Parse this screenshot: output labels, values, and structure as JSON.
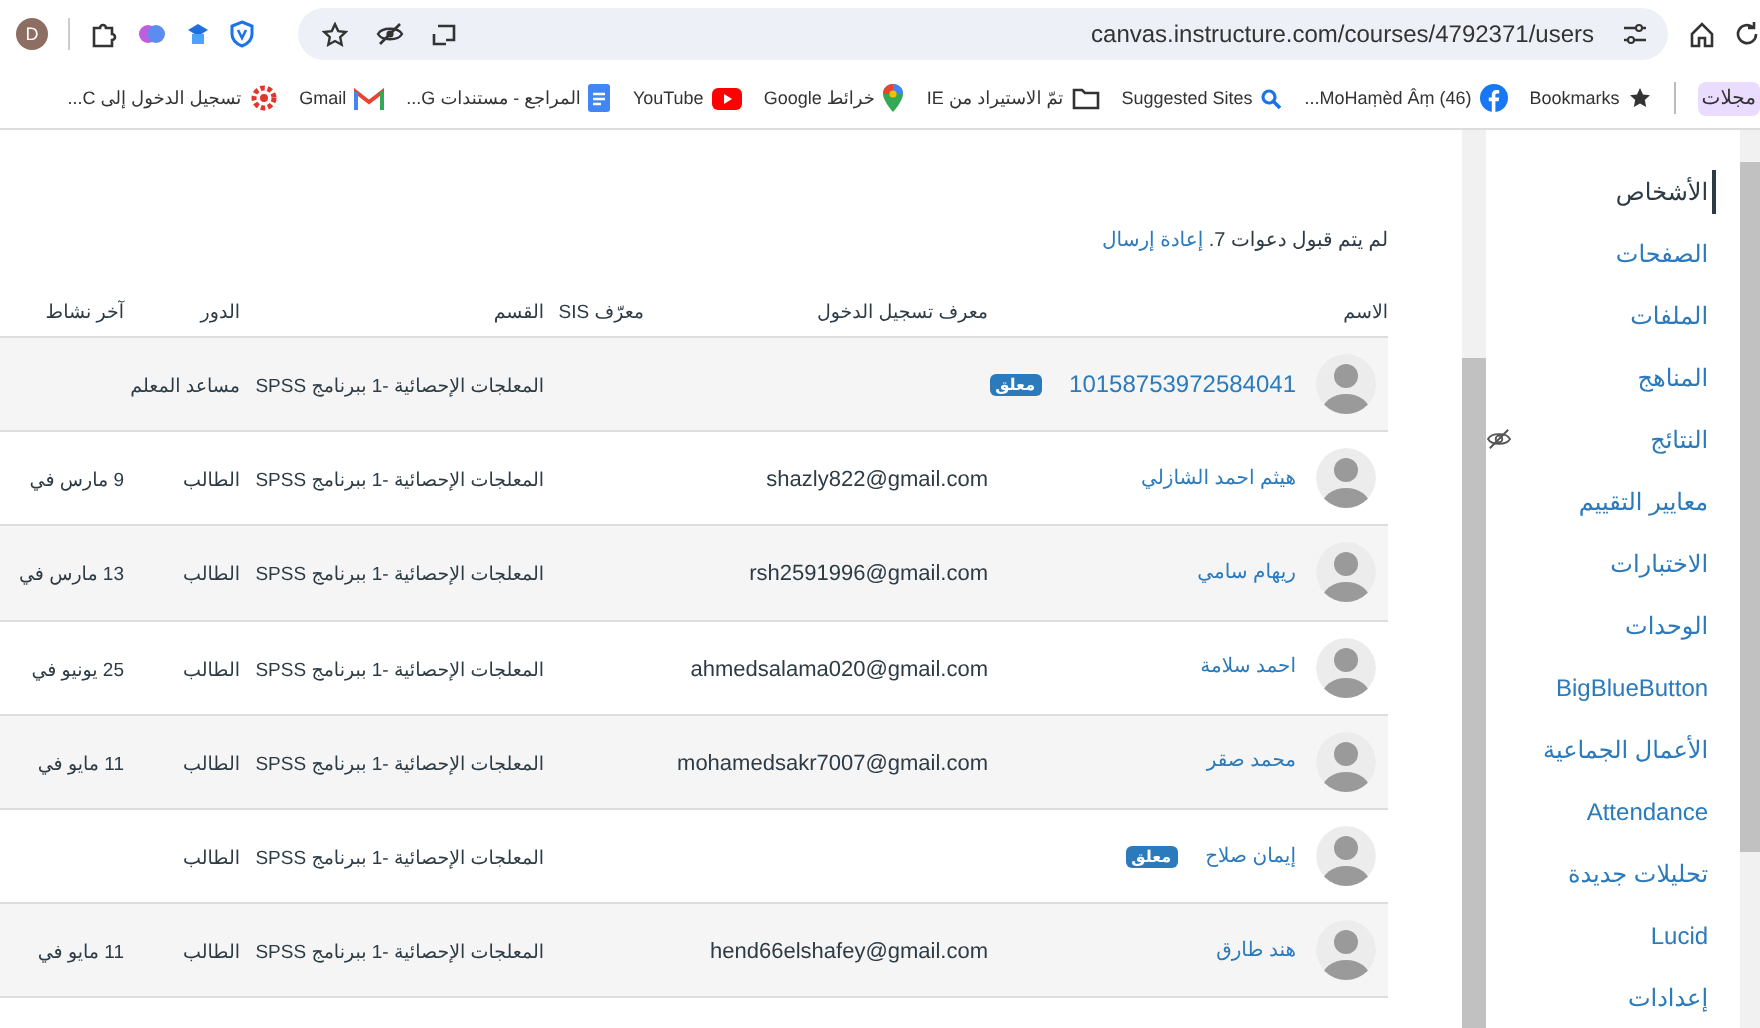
{
  "browser": {
    "profile_initial": "D",
    "url": "canvas.instructure.com/courses/4792371/users",
    "bookmarks": [
      {
        "label": "مجلات",
        "kind": "chip"
      },
      {
        "label": "Bookmarks",
        "kind": "star"
      },
      {
        "label": "(46) MoHaṃèd Âṃ...",
        "kind": "facebook"
      },
      {
        "label": "Suggested Sites",
        "kind": "search"
      },
      {
        "label": "تمّ الاستيراد من IE",
        "kind": "folder"
      },
      {
        "label": "خرائط Google",
        "kind": "maps"
      },
      {
        "label": "YouTube",
        "kind": "youtube"
      },
      {
        "label": "المراجع - مستندات G...",
        "kind": "docs"
      },
      {
        "label": "Gmail",
        "kind": "gmail"
      },
      {
        "label": "تسجيل الدخول إلى C...",
        "kind": "web"
      }
    ]
  },
  "sidebar": {
    "items": [
      {
        "label": "الأشخاص",
        "selected": true,
        "hidden": false
      },
      {
        "label": "الصفحات",
        "selected": false,
        "hidden": false
      },
      {
        "label": "الملفات",
        "selected": false,
        "hidden": false
      },
      {
        "label": "المناهج",
        "selected": false,
        "hidden": false
      },
      {
        "label": "النتائج",
        "selected": false,
        "hidden": true
      },
      {
        "label": "معايير التقييم",
        "selected": false,
        "hidden": false
      },
      {
        "label": "الاختبارات",
        "selected": false,
        "hidden": false
      },
      {
        "label": "الوحدات",
        "selected": false,
        "hidden": false
      },
      {
        "label": "BigBlueButton",
        "selected": false,
        "hidden": false
      },
      {
        "label": "الأعمال الجماعية",
        "selected": false,
        "hidden": false
      },
      {
        "label": "Attendance",
        "selected": false,
        "hidden": false
      },
      {
        "label": "تحليلات جديدة",
        "selected": false,
        "hidden": false
      },
      {
        "label": "Lucid",
        "selected": false,
        "hidden": false
      },
      {
        "label": "إعدادات",
        "selected": false,
        "hidden": false
      }
    ]
  },
  "invitations": {
    "text": "لم يتم قبول دعوات 7.",
    "link": "إعادة إرسال"
  },
  "table": {
    "columns": [
      "الاسم",
      "معرف تسجيل الدخول",
      "معرّف SIS",
      "القسم",
      "الدور",
      "آخر نشاط"
    ],
    "rows": [
      {
        "name": "10158753972584041",
        "badge": "معلق",
        "section": "المعلجات الإحصائية -1 ببرنامج SPSS",
        "role": "مساعد المعلم"
      },
      {
        "name": "هيثم احمد الشازلي",
        "login_id": "shazly822@gmail.com",
        "section": "المعلجات الإحصائية -1 ببرنامج SPSS",
        "role": "الطالب",
        "last_activity": "9 مارس في"
      },
      {
        "name": "ريهام سامي",
        "login_id": "rsh2591996@gmail.com",
        "section": "المعلجات الإحصائية -1 ببرنامج SPSS",
        "role": "الطالب",
        "last_activity": "13 مارس في"
      },
      {
        "name": "احمد سلامة",
        "login_id": "ahmedsalama020@gmail.com",
        "section": "المعلجات الإحصائية -1 ببرنامج SPSS",
        "role": "الطالب",
        "last_activity": "25 يونيو في"
      },
      {
        "name": "محمد صقر",
        "login_id": "mohamedsakr7007@gmail.com",
        "section": "المعلجات الإحصائية -1 ببرنامج SPSS",
        "role": "الطالب",
        "last_activity": "11 مايو في"
      },
      {
        "name": "إيمان صلاح",
        "badge": "معلق",
        "section": "المعلجات الإحصائية -1 ببرنامج SPSS",
        "role": "الطالب"
      },
      {
        "name": "هند طارق",
        "login_id": "hend66elshafey@gmail.com",
        "section": "المعلجات الإحصائية -1 ببرنامج SPSS",
        "role": "الطالب",
        "last_activity": "11 مايو في"
      }
    ]
  }
}
